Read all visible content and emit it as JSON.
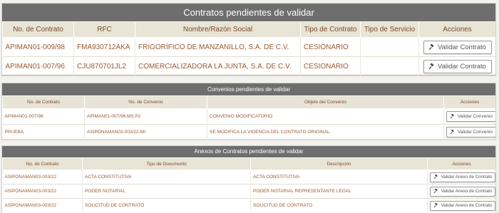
{
  "contratos": {
    "title": "Contratos pendientes de validar",
    "headers": [
      "No. de Contrato",
      "RFC",
      "Nombre/Razón Social",
      "Tipo de Contrato",
      "Tipo de Servicio",
      "Acciones"
    ],
    "rows": [
      {
        "contrato": "APIMAN01-009/98",
        "rfc": "FMA930712AKA",
        "nombre": "FRIGORÍFICO DE MANZANILLO, S.A. DE C.V.",
        "tipo": "CESIONARIO",
        "servicio": "",
        "accion": "Validar Contrato"
      },
      {
        "contrato": "APIMAN01-007/96",
        "rfc": "CJU870701JL2",
        "nombre": "COMERCIALIZADORA LA JUNTA, S.A. DE C.V.",
        "tipo": "CESIONARIO",
        "servicio": "",
        "accion": "Validar Contrato"
      }
    ]
  },
  "convenios": {
    "title": "Convenios pendientes de validar",
    "headers": [
      "No. de Contrato",
      "No. de Convenio",
      "Objeto del Convenio",
      "Acciones"
    ],
    "rows": [
      {
        "contrato": "APIMAN01-007/96",
        "convenio": "APIMAN01-007/96.MS.P2",
        "objeto": "CONVENIO MODIFICATORIO",
        "accion": "Validar Convenio"
      },
      {
        "contrato": "PRUEBA",
        "convenio": "ASIPONAMAN03-003/22-MI",
        "objeto": "SE MODIFICA LA VIGENCIA DEL CONTRATO ORIGINAL.",
        "accion": "Validar Convenio"
      }
    ]
  },
  "anexos": {
    "title": "Anexos de Contratos pendientes de validar",
    "headers": [
      "No. de Contrato",
      "Tipo de Documento",
      "Descripción",
      "Acciones"
    ],
    "rows": [
      {
        "contrato": "ASIPONAMAN03-003/22",
        "tipo": "ACTA CONSTITUTIVA",
        "descripcion": "ACTA CONSTITUTIVA",
        "accion": "Validar Anexo de Contrato"
      },
      {
        "contrato": "ASIPONAMAN03-003/22",
        "tipo": "PODER NOTARIAL",
        "descripcion": "PODER NOTARIAL REPRESENTANTE LEGAL",
        "accion": "Validar Anexo de Contrato"
      },
      {
        "contrato": "ASIPONAMAN03-003/22",
        "tipo": "SOLICITUD DE CONTRATO",
        "descripcion": "SOLICITUD DE CONTRATO",
        "accion": "Validar Anexo de Contrato"
      }
    ]
  },
  "icons": {
    "validate": "gavel-icon"
  },
  "colors": {
    "title_bar": "#6e6e6e",
    "header_bg": "#e8e4d6",
    "text": "#9a5a30"
  }
}
